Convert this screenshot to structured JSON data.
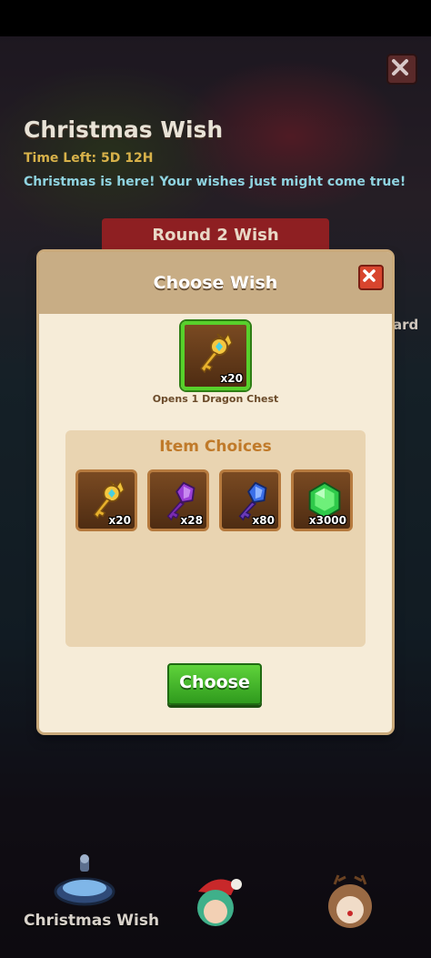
{
  "event": {
    "title": "Christmas Wish",
    "time_left": "Time Left: 5D 12H",
    "description": "Christmas is here! Your wishes just might come true!",
    "round_banner": "Round 2 Wish",
    "partial_label": "ard"
  },
  "modal": {
    "title": "Choose Wish",
    "selected": {
      "icon": "gold-key-icon",
      "quantity": "x20",
      "caption": "Opens 1 Dragon Chest"
    },
    "choices_title": "Item Choices",
    "choices": [
      {
        "icon": "gold-key-icon",
        "quantity": "x20"
      },
      {
        "icon": "purple-key-icon",
        "quantity": "x28"
      },
      {
        "icon": "blue-key-icon",
        "quantity": "x80"
      },
      {
        "icon": "green-gem-icon",
        "quantity": "x3000"
      }
    ],
    "choose_label": "Choose"
  },
  "bottom_nav": {
    "active_label": "Christmas Wish"
  },
  "colors": {
    "accent_green": "#57d12b",
    "banner_red": "#8e1f22",
    "panel_tan": "#e9d4b1"
  }
}
